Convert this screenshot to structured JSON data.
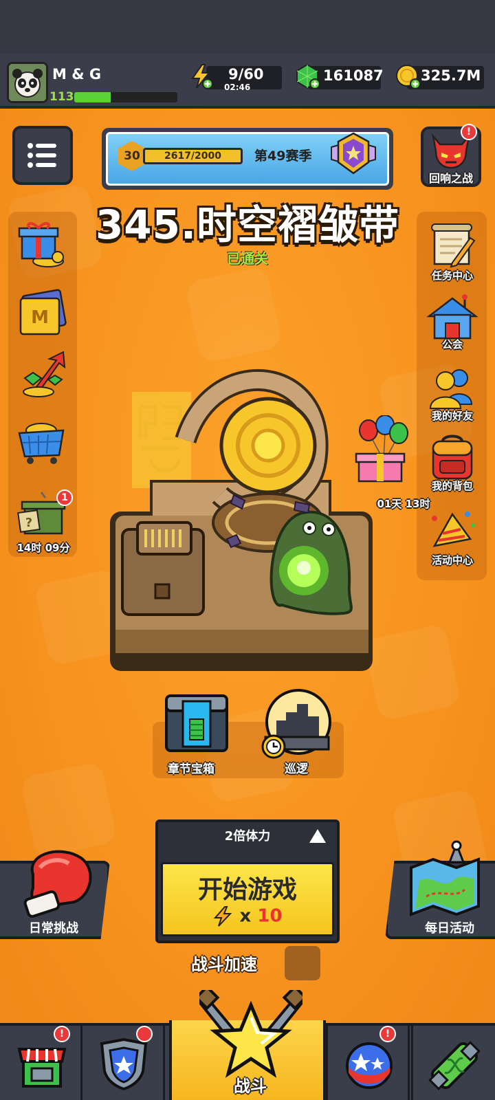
{
  "player": {
    "name": "M & G",
    "level": "113",
    "xp_fraction": 0.35
  },
  "resources": {
    "energy": "9/60",
    "energy_timer": "02:46",
    "gems": "161087",
    "coins": "325.7M"
  },
  "season": {
    "level": "30",
    "progress_text": "2617/2000",
    "progress_fraction": 1.0,
    "title": "第49赛季"
  },
  "echo_battle": {
    "label": "回响之战",
    "badge": "!"
  },
  "stage": {
    "title": "345.时空褶皱带",
    "status": "已通关"
  },
  "left_side": {
    "items": [
      {
        "name": "gift"
      },
      {
        "name": "card"
      },
      {
        "name": "growth"
      },
      {
        "name": "shop-cart"
      },
      {
        "name": "supply-crate",
        "badge": "1",
        "timer": "14时 09分"
      }
    ]
  },
  "right_side": {
    "items": [
      {
        "label": "任务中心"
      },
      {
        "label": "公会"
      },
      {
        "label": "我的好友"
      },
      {
        "label": "我的背包"
      },
      {
        "label": "活动中心"
      }
    ],
    "balloon_gift_timer": "01天 13时"
  },
  "sub_buttons": {
    "chest_label": "章节宝箱",
    "patrol_label": "巡逻"
  },
  "start": {
    "double_label": "2倍体力",
    "button_label": "开始游戏",
    "cost_x": "x",
    "cost_value": "10"
  },
  "daily_challenge": {
    "label": "日常挑战"
  },
  "daily_event": {
    "label": "每日活动"
  },
  "speed": {
    "label": "战斗加速"
  },
  "nav": {
    "active_label": "战斗",
    "badges": {
      "shop": "!",
      "gear": "",
      "gacha": "!"
    }
  },
  "colors": {
    "background": "#f5921f",
    "start_button": "#fde64a",
    "cleared": "#a6ec3a",
    "badge": "#e83a3a"
  }
}
